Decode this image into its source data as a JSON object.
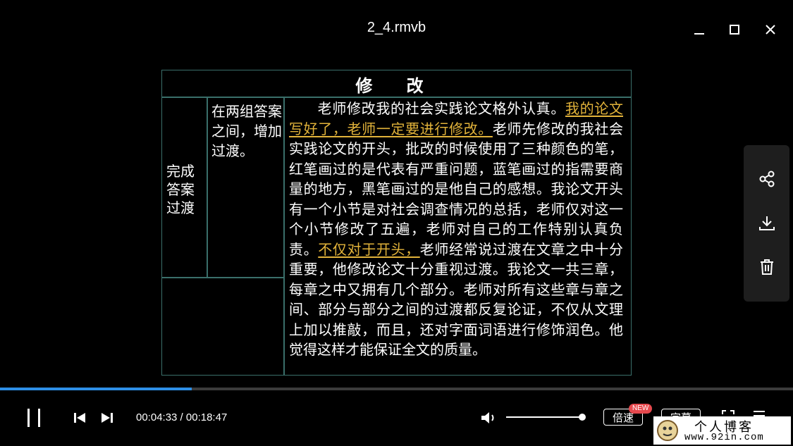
{
  "window": {
    "title": "2_4.rmvb"
  },
  "slide": {
    "header": "修 改",
    "col1": "完成答案过渡",
    "col2": "在两组答案之间，增加过渡。",
    "body_part1": "老师修改我的社会实践论文格外认真。",
    "body_highlight1": "我的论文写好了，老师一定要进行修改。",
    "body_part2": "老师先修改的我社会实践论文的开头，批改的时候使用了三种颜色的笔，红笔画过的是代表有严重问题，蓝笔画过的指需要商量的地方，黑笔画过的是他自己的感想。我论文开头有一个小节是对社会调查情况的总括，老师仅对这一个小节修改了五遍，老师对自己的工作特别认真负责。",
    "body_highlight2": "不仅对于开头，",
    "body_part3": "老师经常说过渡在文章之中十分重要，他修改论文十分重视过渡。我论文一共三章，每章之中又拥有几个部分。老师对所有这些章与章之间、部分与部分之间的过渡都反复论证，不仅从文理上加以推敲，而且，还对字面词语进行修饰润色。他觉得这样才能保证全文的质量。"
  },
  "sidepanel": {
    "icons": [
      "share-icon",
      "download-icon",
      "trash-icon"
    ]
  },
  "player": {
    "current_time": "00:04:33",
    "total_time": "00:18:47",
    "time_display": "00:04:33 / 00:18:47",
    "progress_fraction": 0.242,
    "volume_fraction": 1.0,
    "speed_label": "倍速",
    "new_badge": "NEW",
    "subtitle_label": "字幕"
  },
  "watermark": {
    "line1": "个人博客",
    "line2": "www.92in.com"
  },
  "colors": {
    "accent": "#2e8fe6",
    "highlight": "#e2b33a",
    "badge": "#e5484d",
    "slide_border": "#3a6f6a"
  }
}
